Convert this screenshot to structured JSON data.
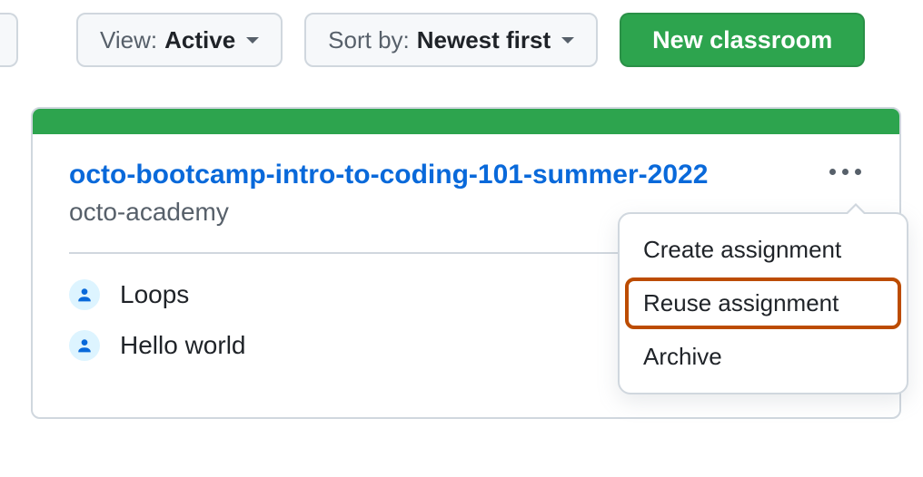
{
  "toolbar": {
    "view_label": "View: ",
    "view_value": "Active",
    "sort_label": "Sort by: ",
    "sort_value": "Newest first",
    "new_classroom": "New classroom"
  },
  "card": {
    "title": "octo-bootcamp-intro-to-coding-101-summer-2022",
    "org": "octo-academy",
    "assignments": [
      {
        "name": "Loops"
      },
      {
        "name": "Hello world"
      }
    ]
  },
  "menu": {
    "items": [
      {
        "label": "Create assignment",
        "highlighted": false
      },
      {
        "label": "Reuse assignment",
        "highlighted": true
      },
      {
        "label": "Archive",
        "highlighted": false
      }
    ]
  }
}
